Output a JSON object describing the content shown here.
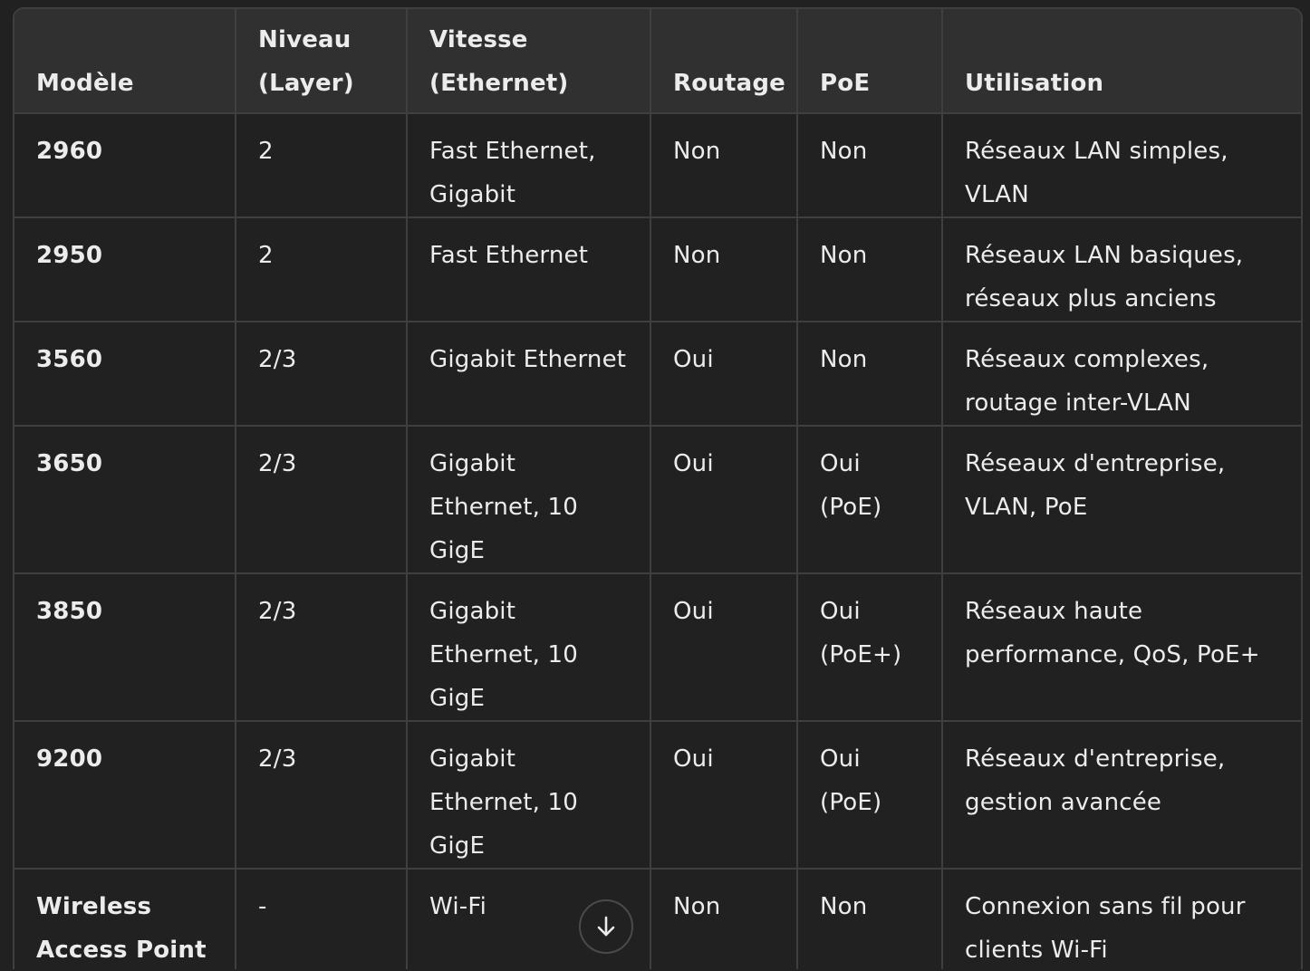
{
  "table": {
    "headers": [
      "Modèle",
      "Niveau (Layer)",
      "Vitesse (Ethernet)",
      "Routage",
      "PoE",
      "Utilisation"
    ],
    "rows": [
      [
        "2960",
        "2",
        "Fast Ethernet, Gigabit",
        "Non",
        "Non",
        "Réseaux LAN simples, VLAN"
      ],
      [
        "2950",
        "2",
        "Fast Ethernet",
        "Non",
        "Non",
        "Réseaux LAN basiques, réseaux plus anciens"
      ],
      [
        "3560",
        "2/3",
        "Gigabit Ethernet",
        "Oui",
        "Non",
        "Réseaux complexes, routage inter-VLAN"
      ],
      [
        "3650",
        "2/3",
        "Gigabit Ethernet, 10 GigE",
        "Oui",
        "Oui (PoE)",
        "Réseaux d'entreprise, VLAN, PoE"
      ],
      [
        "3850",
        "2/3",
        "Gigabit Ethernet, 10 GigE",
        "Oui",
        "Oui (PoE+)",
        "Réseaux haute performance, QoS, PoE+"
      ],
      [
        "9200",
        "2/3",
        "Gigabit Ethernet, 10 GigE",
        "Oui",
        "Oui (PoE)",
        "Réseaux d'entreprise, gestion avancée"
      ],
      [
        "Wireless Access Point",
        "-",
        "Wi-Fi",
        "Non",
        "Non",
        "Connexion sans fil pour clients Wi-Fi"
      ]
    ]
  },
  "scroll_button": {
    "icon": "arrow-down-icon"
  },
  "colors": {
    "background": "#212121",
    "header_background": "#303030",
    "border": "#3f3f3f",
    "text": "#ececec"
  }
}
